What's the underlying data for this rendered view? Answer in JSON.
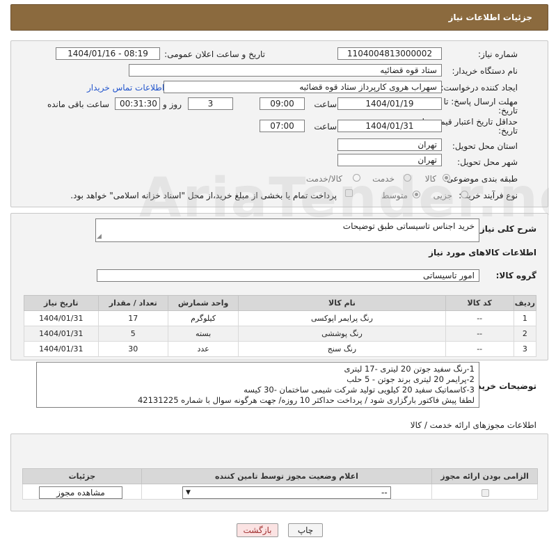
{
  "header": {
    "title": "جزئیات اطلاعات نیاز"
  },
  "form": {
    "need_number_label": "شماره نیاز:",
    "need_number": "1104004813000002",
    "announce_label": "تاریخ و ساعت اعلان عمومی:",
    "announce_value": "1404/01/16 - 08:19",
    "buyer_org_label": "نام دستگاه خریدار:",
    "buyer_org": "ستاد قوه قضائیه",
    "creator_label": "ایجاد کننده درخواست:",
    "creator": "سهراب هروی کارپرداز ستاد قوه قضائیه",
    "contact_link": "اطلاعات تماس خریدار",
    "deadline_label_1": "مهلت ارسال پاسخ: تا",
    "deadline_label_2": "تاریخ:",
    "deadline_date": "1404/01/19",
    "hour_label": "ساعت",
    "deadline_time": "09:00",
    "days_value": "3",
    "days_label": "روز و",
    "remaining_value": "00:31:30",
    "remaining_label": "ساعت باقی مانده",
    "validity_label_1": "حداقل تاریخ اعتبار قیمت: تا",
    "validity_label_2": "تاریخ:",
    "validity_date": "1404/01/31",
    "validity_time": "07:00",
    "province_label": "استان محل تحویل:",
    "province": "تهران",
    "city_label": "شهر محل تحویل:",
    "city": "تهران",
    "category_label": "طبقه بندی موضوعی:",
    "category_options": [
      "کالا",
      "خدمت",
      "کالا/خدمت"
    ],
    "process_label": "نوع فرآیند خرید :",
    "process_options": [
      "جزیی",
      "متوسط"
    ],
    "payment_note": "پرداخت تمام یا بخشی از مبلغ خرید،از محل \"اسناد خزانه اسلامی\" خواهد بود."
  },
  "description": {
    "label": "شرح کلی نیاز:",
    "value": "خرید اجناس تاسیساتی طبق توضیحات",
    "goods_info_title": "اطلاعات کالاهای مورد نیاز",
    "group_label": "گروه کالا:",
    "group_value": "امور تاسیساتی"
  },
  "items_table": {
    "headers": [
      "ردیف",
      "کد کالا",
      "نام کالا",
      "واحد شمارش",
      "تعداد / مقدار",
      "تاریخ نیاز"
    ],
    "rows": [
      [
        "1",
        "--",
        "رنگ پرایمر اپوکسی",
        "کیلوگرم",
        "17",
        "1404/01/31"
      ],
      [
        "2",
        "--",
        "رنگ پوششی",
        "بسته",
        "5",
        "1404/01/31"
      ],
      [
        "3",
        "--",
        "رنگ سنج",
        "عدد",
        "30",
        "1404/01/31"
      ]
    ]
  },
  "buyer_notes": {
    "label": "توضیحات خریدار:",
    "lines": [
      "1-رنگ سفید جوتن 20 لیتری -17 لیتری",
      "2-پرایمر 20 لیتری برند جوتن - 5 حلب",
      "3-کاسماتیک سفید 20 کیلویی تولید شرکت شیمی ساختمان -30 کیسه",
      "لطفا پیش فاکتور بارگزاری شود / پرداخت حداکثر 10 روزه/ جهت هرگونه سوال با شماره 42131225"
    ]
  },
  "permits": {
    "title": "اطلاعات مجوزهای ارائه خدمت / کالا",
    "headers": [
      "الزامی بودن ارائه مجوز",
      "اعلام وضعیت مجوز توسط تامین کننده",
      "جزئیات"
    ],
    "select_value": "--",
    "view_button": "مشاهده مجوز"
  },
  "actions": {
    "print": "چاپ",
    "back": "بازگشت"
  },
  "watermark": "AriaTender.neT"
}
